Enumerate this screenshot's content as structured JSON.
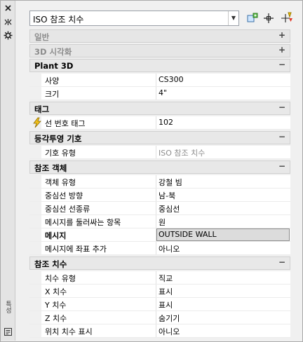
{
  "toolbar": {
    "selector_value": "ISO 참조 치수",
    "buttons": [
      "quick-select-icon",
      "pick-add-icon",
      "toggle-pickadd-icon"
    ]
  },
  "palette": {
    "side_title": "특성",
    "side_icons": [
      "close-icon",
      "autohide-icon",
      "settings-icon"
    ]
  },
  "categories": [
    {
      "title": "일반",
      "collapsed": true,
      "toggle": "+",
      "rows": []
    },
    {
      "title": "3D 시각화",
      "collapsed": true,
      "toggle": "+",
      "rows": []
    },
    {
      "title": "Plant 3D",
      "collapsed": false,
      "toggle": "−",
      "rows": [
        {
          "name": "사양",
          "value": "CS300"
        },
        {
          "name": "크기",
          "value": "4\""
        }
      ]
    },
    {
      "title": "태그",
      "collapsed": false,
      "toggle": "−",
      "rows": [
        {
          "name": "선 번호 태그",
          "value": "102",
          "icon": "bolt-icon"
        }
      ]
    },
    {
      "title": "등각투영 기호",
      "collapsed": false,
      "toggle": "−",
      "rows": [
        {
          "name": "기호 유형",
          "value": "ISO 참조 치수",
          "gray": true
        }
      ]
    },
    {
      "title": "참조 객체",
      "collapsed": false,
      "toggle": "−",
      "rows": [
        {
          "name": "객체 유형",
          "value": "강철 빔"
        },
        {
          "name": "중심선 방향",
          "value": "남-북"
        },
        {
          "name": "중심선 선종류",
          "value": "중심선"
        },
        {
          "name": "메시지를 둘러싸는 항목",
          "value": "원"
        },
        {
          "name": "메시지",
          "value": "OUTSIDE WALL",
          "selected": true
        },
        {
          "name": "메시지에 좌표 추가",
          "value": "아니오"
        }
      ]
    },
    {
      "title": "참조 치수",
      "collapsed": false,
      "toggle": "−",
      "rows": [
        {
          "name": "치수 유형",
          "value": "직교"
        },
        {
          "name": "X 치수",
          "value": "표시"
        },
        {
          "name": "Y 치수",
          "value": "표시"
        },
        {
          "name": "Z 치수",
          "value": "숨기기"
        },
        {
          "name": "위치 치수 표시",
          "value": "아니오"
        }
      ]
    }
  ]
}
